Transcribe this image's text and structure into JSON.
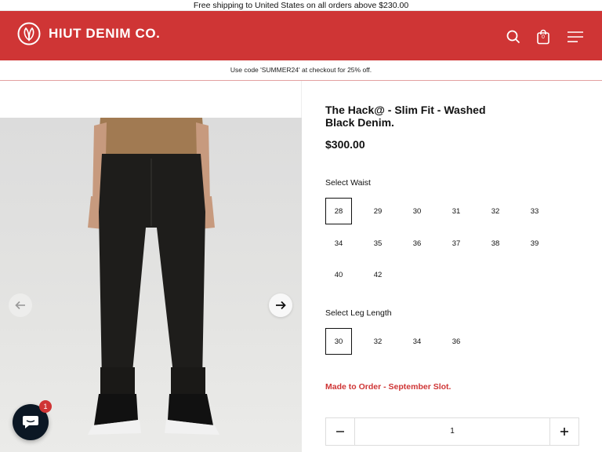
{
  "announcement": "Free shipping to United States on all orders above $230.00",
  "header": {
    "brand": "HIUT DENIM CO.",
    "cart_count": "0",
    "icons": [
      "search-icon",
      "bag-icon",
      "menu-icon"
    ]
  },
  "promo": "Use code 'SUMMER24' at checkout for 25% off.",
  "gallery": {
    "prev_icon": "arrow-left-icon",
    "next_icon": "arrow-right-icon"
  },
  "product": {
    "title": "The Hack@ - Slim Fit - Washed Black Denim.",
    "price": "$300.00",
    "waist_label": "Select Waist",
    "waist_options": [
      "28",
      "29",
      "30",
      "31",
      "32",
      "33",
      "34",
      "35",
      "36",
      "37",
      "38",
      "39",
      "40",
      "42"
    ],
    "waist_selected": "28",
    "leg_label": "Select Leg Length",
    "leg_options": [
      "30",
      "32",
      "34",
      "36"
    ],
    "leg_selected": "30",
    "made_to_order": "Made to Order - September Slot.",
    "quantity": "1"
  },
  "chat": {
    "badge": "1"
  },
  "colors": {
    "brand_red": "#cf3535",
    "chat_dark": "#0b1724"
  }
}
